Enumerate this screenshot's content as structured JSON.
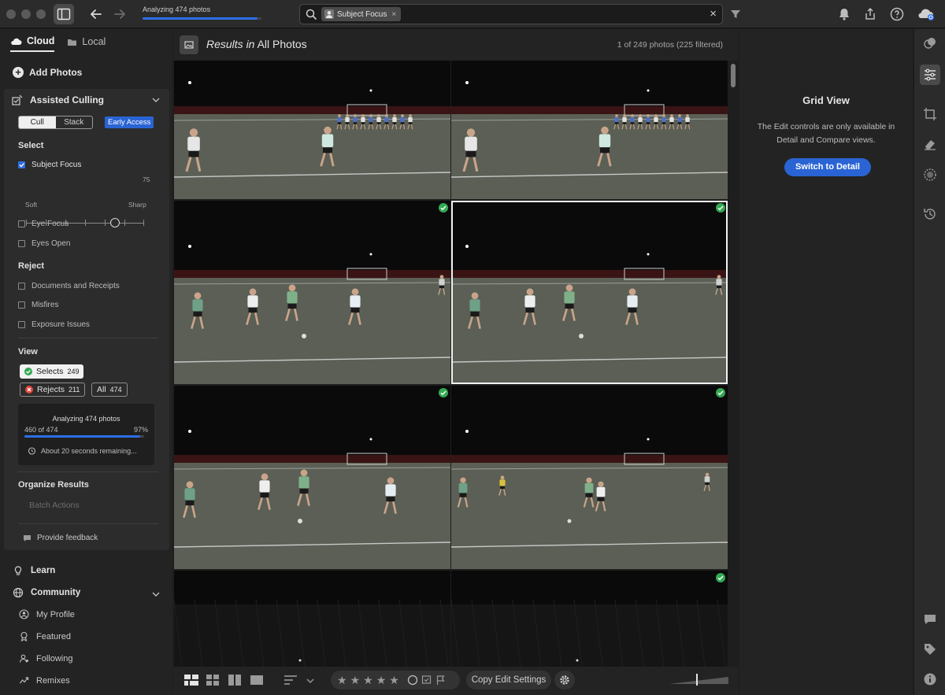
{
  "topbar": {
    "progress_label": "Analyzing 474 photos",
    "progress_fraction": 0.97,
    "search_chip": "Subject Focus",
    "chip_close": "×",
    "search_clear": "×"
  },
  "left": {
    "tabs": [
      {
        "label": "Cloud"
      },
      {
        "label": "Local"
      }
    ],
    "add_photos": "Add Photos",
    "culling": {
      "title": "Assisted Culling",
      "mode_cull": "Cull",
      "mode_stack": "Stack",
      "badge": "Early Access",
      "select_title": "Select",
      "subject_focus": "Subject Focus",
      "slider_value": "75",
      "slider_level": 0.75,
      "slider_min": "Soft",
      "slider_max": "Sharp",
      "eye_focus": "Eye Focus",
      "eyes_open": "Eyes Open",
      "reject_title": "Reject",
      "reject_items": [
        {
          "label": "Documents and Receipts"
        },
        {
          "label": "Misfires"
        },
        {
          "label": "Exposure Issues"
        }
      ],
      "view_title": "View",
      "selects_label": "Selects",
      "selects_count": "249",
      "rejects_label": "Rejects",
      "rejects_count": "211",
      "all_label": "All",
      "all_count": "474",
      "analyze_title": "Analyzing 474 photos",
      "analyze_progress": "460 of 474",
      "analyze_percent": "97%",
      "analyze_fraction": 0.97,
      "analyze_time": "About 20 seconds remaining...",
      "organize_title": "Organize Results",
      "batch_actions": "Batch Actions",
      "feedback": "Provide feedback"
    },
    "lower": {
      "learn": "Learn",
      "community": "Community",
      "my_profile": "My Profile",
      "featured": "Featured",
      "following": "Following",
      "remixes": "Remixes"
    }
  },
  "center": {
    "results_prefix": "Results in",
    "results_scope": " All Photos",
    "results_count": "1 of 249 photos  (225 filtered)",
    "copy_edit": "Copy Edit Settings",
    "stars": [
      "★",
      "★",
      "★",
      "★",
      "★"
    ]
  },
  "right": {
    "title": "Grid View",
    "text": "The Edit controls are only available in Detail and Compare views.",
    "button": "Switch to Detail"
  },
  "colors": {
    "accent": "#2d6ee6",
    "button_blue": "#2a64d4",
    "pick_green": "#34a853",
    "reject_red": "#e0453a"
  }
}
